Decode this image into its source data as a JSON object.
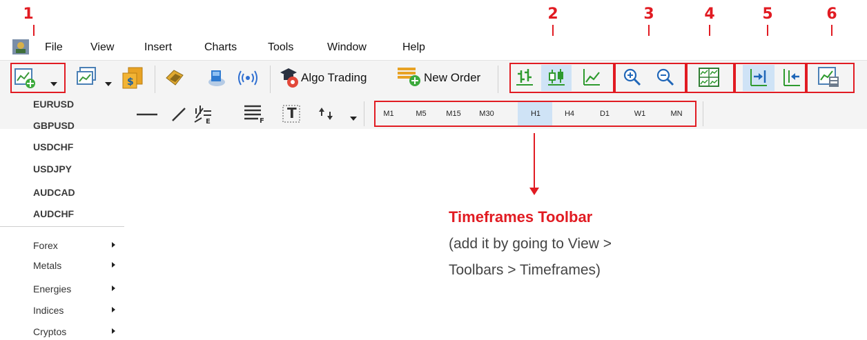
{
  "annotations": {
    "numbers": [
      "1",
      "2",
      "3",
      "4",
      "5",
      "6"
    ],
    "note": {
      "title": "Timeframes Toolbar",
      "line1": "(add it by going to View >",
      "line2": "Toolbars > Timeframes)"
    },
    "accent_color": "#e11b22"
  },
  "menu": {
    "items": [
      "File",
      "View",
      "Insert",
      "Charts",
      "Tools",
      "Window",
      "Help"
    ]
  },
  "toolbar": {
    "algo_trading_label": "Algo Trading",
    "new_order_label": "New Order",
    "icons": [
      "new-chart-icon",
      "profiles-icon",
      "market-watch-icon",
      "trading-icon",
      "navigator-icon",
      "signals-icon",
      "algo-trading-icon",
      "new-order-icon",
      "bar-chart-icon",
      "candlestick-icon",
      "line-chart-icon",
      "zoom-in-icon",
      "zoom-out-icon",
      "tile-windows-icon",
      "autoscroll-icon",
      "chart-shift-icon",
      "templates-icon"
    ]
  },
  "line_studies": {
    "text_tool": "T"
  },
  "timeframes": {
    "items": [
      "M1",
      "M5",
      "M15",
      "M30",
      "H1",
      "H4",
      "D1",
      "W1",
      "MN"
    ],
    "selected": "H1"
  },
  "market_watch": {
    "symbols": [
      "EURUSD",
      "GBPUSD",
      "USDCHF",
      "USDJPY",
      "AUDCAD",
      "AUDCHF"
    ]
  },
  "navigator": {
    "categories": [
      "Forex",
      "Metals",
      "Energies",
      "Indices",
      "Cryptos"
    ]
  }
}
